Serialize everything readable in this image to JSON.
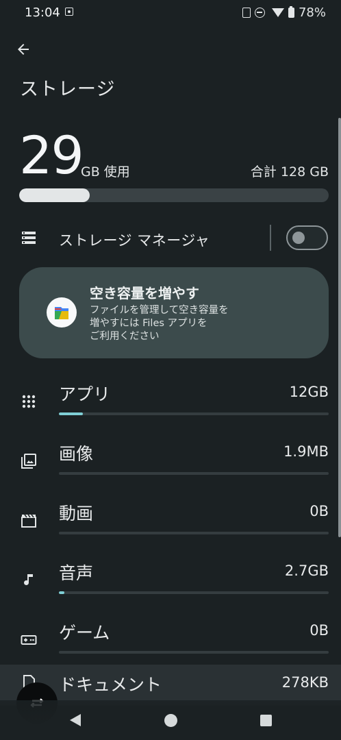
{
  "status_bar": {
    "time": "13:04",
    "battery_text": "78%"
  },
  "header": {
    "back_icon": "arrow-back-icon",
    "title": "ストレージ"
  },
  "summary": {
    "used_number": "29",
    "used_unit": "GB 使用",
    "total_label": "合計 128 GB",
    "used_fraction": 0.227
  },
  "storage_manager": {
    "icon": "storage-list-icon",
    "label": "ストレージ マネージャ",
    "enabled": false
  },
  "files_card": {
    "icon": "files-by-google-logo",
    "title": "空き容量を増やす",
    "description": "ファイルを管理して空き容量を\n増やすには Files アプリを\nご利用ください"
  },
  "categories": [
    {
      "icon": "apps-grid-icon",
      "label": "アプリ",
      "value": "12GB",
      "fraction": 0.09
    },
    {
      "icon": "image-icon",
      "label": "画像",
      "value": "1.9MB",
      "fraction": 0.0
    },
    {
      "icon": "video-icon",
      "label": "動画",
      "value": "0B",
      "fraction": 0.0
    },
    {
      "icon": "music-note-icon",
      "label": "音声",
      "value": "2.7GB",
      "fraction": 0.02
    },
    {
      "icon": "gamepad-icon",
      "label": "ゲーム",
      "value": "0B",
      "fraction": 0.0
    },
    {
      "icon": "document-icon",
      "label": "ドキュメント",
      "value": "278KB",
      "fraction": 0.0
    }
  ],
  "fab": {
    "icon": "rotate-icon"
  },
  "colors": {
    "background": "#1b2123",
    "card": "#3c4b4c",
    "accent": "#7fcfd5",
    "bar_track": "#3a4245"
  }
}
